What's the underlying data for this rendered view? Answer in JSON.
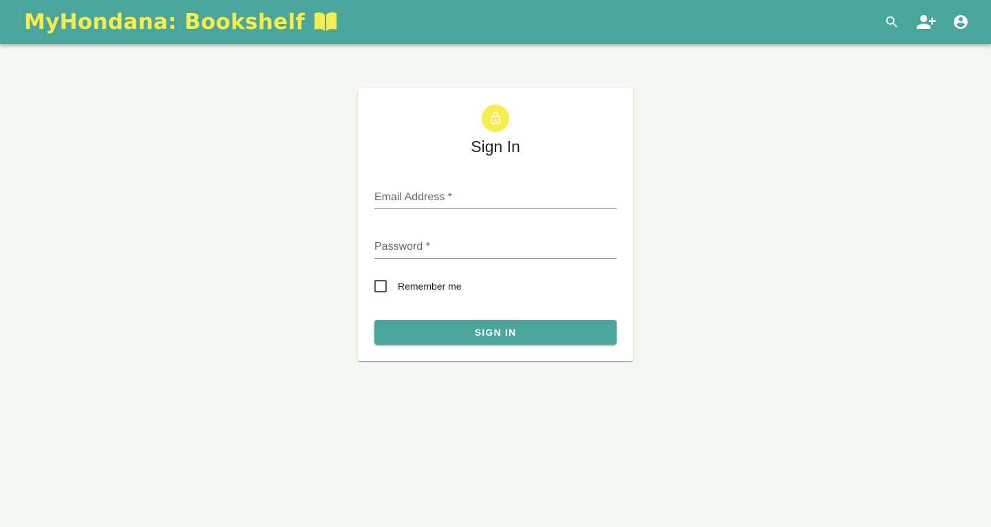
{
  "header": {
    "title": "MyHondana: Bookshelf",
    "logo_icon": "open-book-icon",
    "actions": [
      {
        "name": "search-icon"
      },
      {
        "name": "person-add-icon"
      },
      {
        "name": "account-circle-icon"
      }
    ]
  },
  "signin": {
    "avatar_icon": "lock-icon",
    "title": "Sign In",
    "email_label": "Email Address *",
    "email_value": "",
    "password_label": "Password *",
    "password_value": "",
    "remember_label": "Remember me",
    "remember_checked": false,
    "submit_label": "SIGN IN"
  },
  "colors": {
    "primary": "#4aa69a",
    "accent": "#f5ec4f",
    "background": "#f3f8f1"
  }
}
